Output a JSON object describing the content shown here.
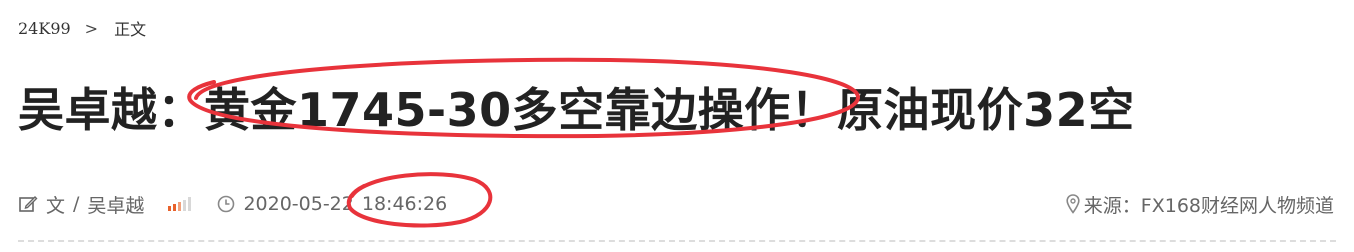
{
  "breadcrumb": {
    "home": "24K99",
    "separator": ">",
    "current": "正文"
  },
  "article": {
    "title": "吴卓越：黄金1745-30多空靠边操作！原油现价32空",
    "author_prefix": "文",
    "author_slash": "/",
    "author": "吴卓越",
    "date": "2020-05-22",
    "time": "18:46:26",
    "source_label": "来源：",
    "source": "FX168财经网人物频道"
  },
  "icons": {
    "edit": "edit-icon",
    "signal": "signal-strength-icon",
    "clock": "clock-icon",
    "location": "location-pin-icon"
  },
  "colors": {
    "annotation": "#e8333b",
    "signal_active": "#e8622c",
    "signal_inactive": "#d8d8d8",
    "text_primary": "#222222",
    "text_meta": "#666666"
  }
}
